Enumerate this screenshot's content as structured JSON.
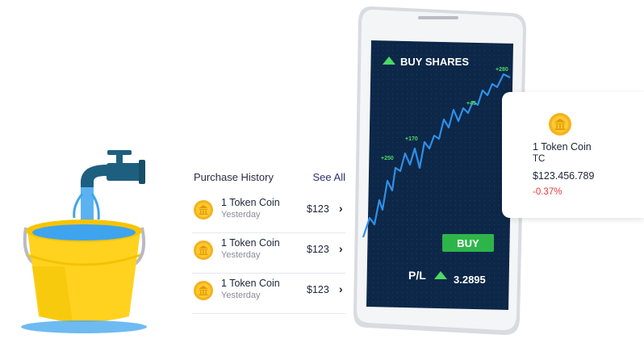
{
  "purchase_history": {
    "title": "Purchase History",
    "see_all": "See All",
    "items": [
      {
        "name": "1 Token Coin",
        "date": "Yesterday",
        "amount": "$123",
        "icon": "bank-coin-icon"
      },
      {
        "name": "1 Token Coin",
        "date": "Yesterday",
        "amount": "$123",
        "icon": "bank-coin-icon"
      },
      {
        "name": "1 Token Coin",
        "date": "Yesterday",
        "amount": "$123",
        "icon": "bank-coin-icon"
      }
    ]
  },
  "phone": {
    "header": "BUY SHARES",
    "button": "BUY",
    "pl_label": "P/L",
    "pl_value": "3.2895",
    "chart_labels": [
      "+250",
      "+170",
      "+45",
      "+280"
    ]
  },
  "stock_card": {
    "name": "1 Token Coin",
    "symbol": "TC",
    "price": "$123.456.789",
    "change": "-0.37%",
    "icon": "bank-coin-icon"
  },
  "colors": {
    "screen_bg": "#0d2748",
    "chart_line": "#2f8fe8",
    "buy_button": "#2db54a",
    "gain": "#4cd964",
    "loss": "#e53935",
    "coin": "#f5b21b",
    "bucket": "#ffd21f",
    "water": "#3ea4ee"
  }
}
